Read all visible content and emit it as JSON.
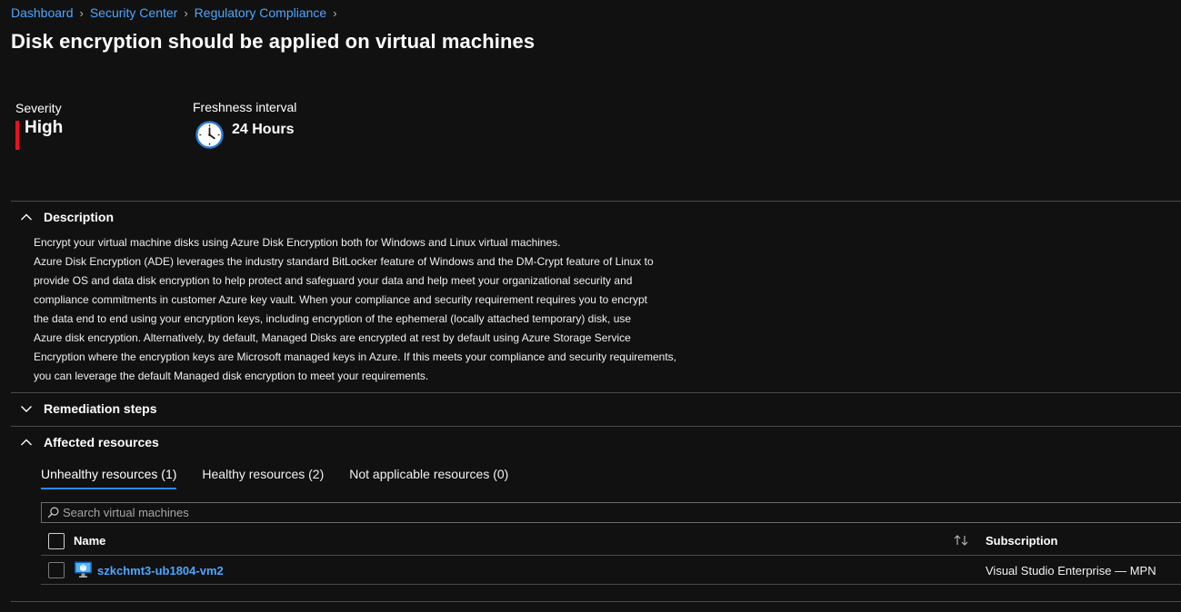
{
  "breadcrumb": [
    "Dashboard",
    "Security Center",
    "Regulatory Compliance"
  ],
  "title": "Disk encryption should be applied on virtual machines",
  "severity": {
    "label": "Severity",
    "value": "High",
    "color": "#e81123"
  },
  "freshness": {
    "label": "Freshness interval",
    "value": "24 Hours"
  },
  "sections": {
    "description": {
      "label": "Description",
      "expanded": true,
      "lines": [
        "Encrypt your virtual machine disks using Azure Disk Encryption both for Windows and Linux virtual machines.",
        "Azure Disk Encryption (ADE) leverages the industry standard BitLocker feature of Windows and the DM-Crypt feature of Linux to",
        "provide OS and data disk encryption to help protect and safeguard your data and help meet your organizational security and",
        "compliance commitments in customer Azure key vault. When your compliance and security requirement requires you to encrypt",
        "the data end to end using your encryption keys, including encryption of the ephemeral (locally attached temporary) disk, use",
        "Azure disk encryption. Alternatively, by default, Managed Disks are encrypted at rest by default using Azure Storage Service",
        "Encryption where the encryption keys are Microsoft managed keys in Azure. If this meets your compliance and security requirements,",
        "you can leverage the default Managed disk encryption to meet your requirements."
      ]
    },
    "remediation": {
      "label": "Remediation steps",
      "expanded": false
    },
    "affected": {
      "label": "Affected resources",
      "expanded": true
    }
  },
  "tabs": [
    {
      "label": "Unhealthy resources (1)",
      "active": true
    },
    {
      "label": "Healthy resources (2)",
      "active": false
    },
    {
      "label": "Not applicable resources (0)",
      "active": false
    }
  ],
  "search": {
    "placeholder": "Search virtual machines"
  },
  "table": {
    "columns": {
      "name": "Name",
      "subscription": "Subscription"
    },
    "rows": [
      {
        "name": "szkchmt3-ub1804-vm2",
        "subscription": "Visual Studio Enterprise — MPN"
      }
    ]
  },
  "colors": {
    "accent": "#2f88f0",
    "link": "#4ea6ff",
    "background": "#111111"
  }
}
